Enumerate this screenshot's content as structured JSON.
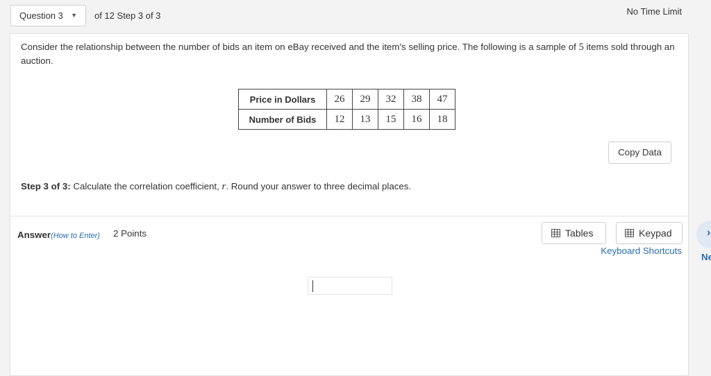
{
  "header": {
    "question_selector": "Question 3",
    "step_info": "of 12 Step 3 of 3",
    "time_limit": "No Time Limit"
  },
  "question": {
    "prompt_part1": "Consider the relationship between the number of bids an item on eBay received and the item's selling price. The following is a sample of ",
    "sample_size": "5",
    "prompt_part2": " items sold through an auction.",
    "table": {
      "row1_label": "Price in Dollars",
      "row1_values": [
        "26",
        "29",
        "32",
        "38",
        "47"
      ],
      "row2_label": "Number of Bids",
      "row2_values": [
        "12",
        "13",
        "15",
        "16",
        "18"
      ]
    },
    "copy_data_label": "Copy Data",
    "step_label": "Step 3 of 3:",
    "step_text_before": " Calculate the correlation coefficient, ",
    "step_variable": "r",
    "step_text_after": ". Round your answer to three decimal places."
  },
  "answer": {
    "label": "Answer",
    "how_to_enter": "(How to Enter)",
    "points": "2 Points",
    "tables_button": "Tables",
    "keypad_button": "Keypad",
    "keyboard_shortcuts": "Keyboard Shortcuts",
    "input_value": ""
  },
  "nav": {
    "next_arrow": "›",
    "next_label": "Ne"
  }
}
